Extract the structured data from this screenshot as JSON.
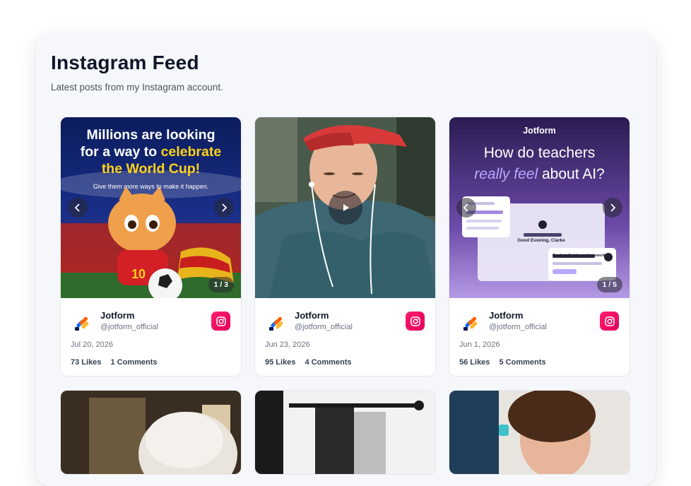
{
  "page": {
    "title": "Instagram Feed",
    "subtitle": "Latest posts from my Instagram account."
  },
  "posts": [
    {
      "account_name": "Jotform",
      "handle": "@jotform_official",
      "date": "Jul 20, 2026",
      "likes": "73 Likes",
      "comments": "1 Comments",
      "counter": "1 / 3",
      "media_line1": "Millions are looking",
      "media_line2_a": "for a way to ",
      "media_line2_b": "celebrate",
      "media_line3": "the World Cup!",
      "media_caption": "Give them more ways to make it happen."
    },
    {
      "account_name": "Jotform",
      "handle": "@jotform_official",
      "date": "Jun 23, 2026",
      "likes": "95 Likes",
      "comments": "4 Comments"
    },
    {
      "account_name": "Jotform",
      "handle": "@jotform_official",
      "date": "Jun 1, 2026",
      "likes": "56 Likes",
      "comments": "5 Comments",
      "counter": "1 / 5",
      "media_brand": "Jotform",
      "media_line1": "How do teachers",
      "media_line2_a": "really feel",
      "media_line2_b": " about AI?",
      "media_greeting": "Good Evening, Clarke",
      "media_prompt": "Ready to finish your homework?"
    }
  ],
  "colors": {
    "instagram": "#ff1f6e",
    "accent_yellow": "#ffd21a",
    "accent_lilac": "#b9a8ff"
  },
  "icons": [
    "chevron-left-icon",
    "chevron-right-icon",
    "play-icon",
    "instagram-icon",
    "jotform-logo-icon"
  ]
}
